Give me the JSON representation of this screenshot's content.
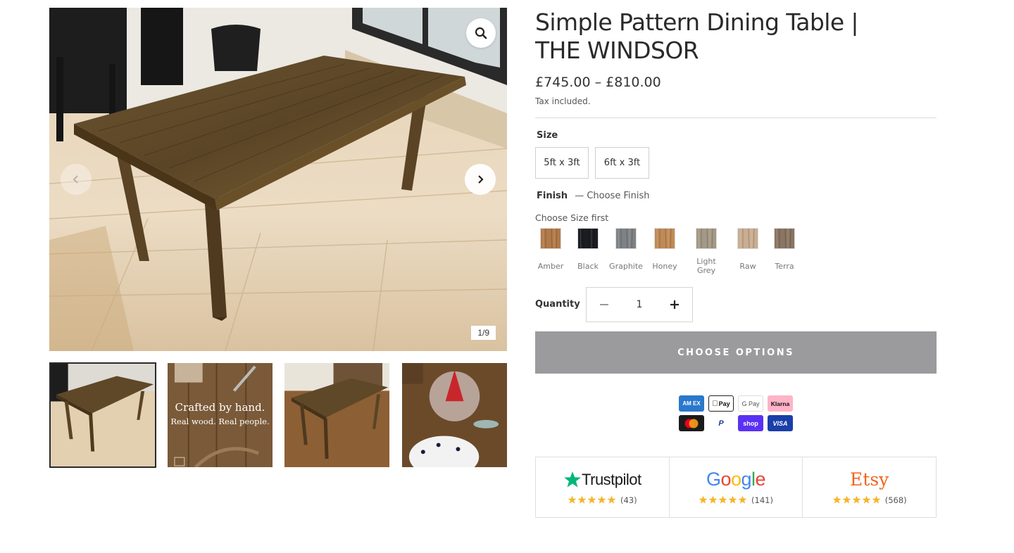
{
  "gallery": {
    "counter": "1/9",
    "thumbnail_caption": {
      "line1": "Crafted by hand.",
      "line2": "Real wood. Real people."
    }
  },
  "product": {
    "title_line1": "Simple Pattern Dining Table |",
    "title_line2": "THE WINDSOR",
    "price": "£745.00 – £810.00",
    "tax_note": "Tax included."
  },
  "options": {
    "size_label": "Size",
    "sizes": [
      "5ft x 3ft",
      "6ft x 3ft"
    ],
    "finish_label": "Finish",
    "finish_dash": "—",
    "finish_value": "Choose Finish",
    "finish_hint": "Choose Size first",
    "finishes": [
      {
        "name": "Amber",
        "color": "#b27a4a"
      },
      {
        "name": "Black",
        "color": "#1c1d22"
      },
      {
        "name": "Graphite",
        "color": "#7f8284"
      },
      {
        "name": "Honey",
        "color": "#c08a55"
      },
      {
        "name": "Light Grey",
        "color": "#a39986"
      },
      {
        "name": "Raw",
        "color": "#c9ad90"
      },
      {
        "name": "Terra",
        "color": "#8a7563"
      }
    ]
  },
  "quantity": {
    "label": "Quantity",
    "value": "1"
  },
  "cta": {
    "label": "CHOOSE OPTIONS"
  },
  "payments": {
    "amex": "AM EX",
    "apple_pay": "Pay",
    "google_pay": "G Pay",
    "klarna": "Klarna",
    "paypal": "P",
    "shop_pay": "shop",
    "visa": "VISA"
  },
  "reviews": [
    {
      "brand": "Trustpilot",
      "count": "(43)"
    },
    {
      "brand": "Google",
      "count": "(141)"
    },
    {
      "brand": "Etsy",
      "count": "(568)"
    }
  ],
  "colors": {
    "cta_bg": "#9b9b9e",
    "trustpilot_green": "#00b67a",
    "star_gold": "#f5b62c",
    "etsy_orange": "#f1641e"
  }
}
